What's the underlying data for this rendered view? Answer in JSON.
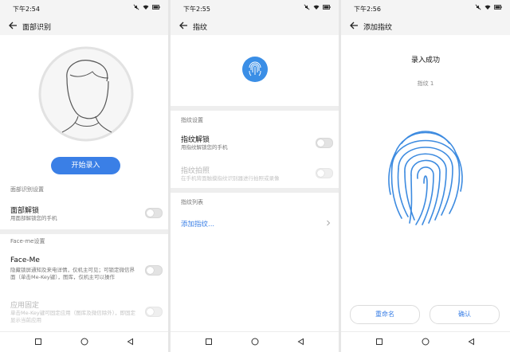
{
  "panels": [
    {
      "status_time": "下午2:54",
      "title": "面部识别",
      "enroll_button": "开始录入",
      "section_face": "面部识别设置",
      "face_unlock_title": "面部解锁",
      "face_unlock_sub": "用面部解锁您的手机",
      "face_unlock_on": false,
      "section_faceme": "Face-me设置",
      "faceme_title": "Face-Me",
      "faceme_sub": "隐藏锁屏通知及来电详情，仅机主可见；可锁定微信界面（单击Me-Key键），图库，仅机主可以操作",
      "faceme_on": false,
      "app_lock_title": "应用固定",
      "app_lock_sub": "单击Me-Key键可固定应用（图库及微信除外），即固定显示当前应用",
      "app_lock_on": false
    },
    {
      "status_time": "下午2:55",
      "title": "指纹",
      "section_fp": "指纹设置",
      "fp_unlock_title": "指纹解锁",
      "fp_unlock_sub": "用指纹解锁您的手机",
      "fp_unlock_on": false,
      "fp_photo_title": "指纹拍照",
      "fp_photo_sub": "在手机背面触摸指纹识别器进行拍照或录像",
      "fp_photo_on": false,
      "section_list": "指纹列表",
      "add_fp": "添加指纹..."
    },
    {
      "status_time": "下午2:56",
      "title": "添加指纹",
      "success": "录入成功",
      "fp_name": "指纹 1",
      "rename_button": "重命名",
      "confirm_button": "确认"
    }
  ],
  "colors": {
    "accent": "#3a7fe6",
    "fingerprint_blue": "#3d8be0",
    "background": "#ffffff",
    "bar_background": "#f4f4f4",
    "divider": "#eeeeee"
  },
  "icons": {
    "status": [
      "mute-icon",
      "wifi-icon",
      "battery-icon"
    ],
    "back": "arrow-left-icon",
    "nav": [
      "square-recent-icon",
      "circle-home-icon",
      "triangle-back-icon"
    ],
    "chevron": "chevron-right-icon",
    "avatar": "face-outline-icon",
    "fingerprint": "fingerprint-icon"
  }
}
